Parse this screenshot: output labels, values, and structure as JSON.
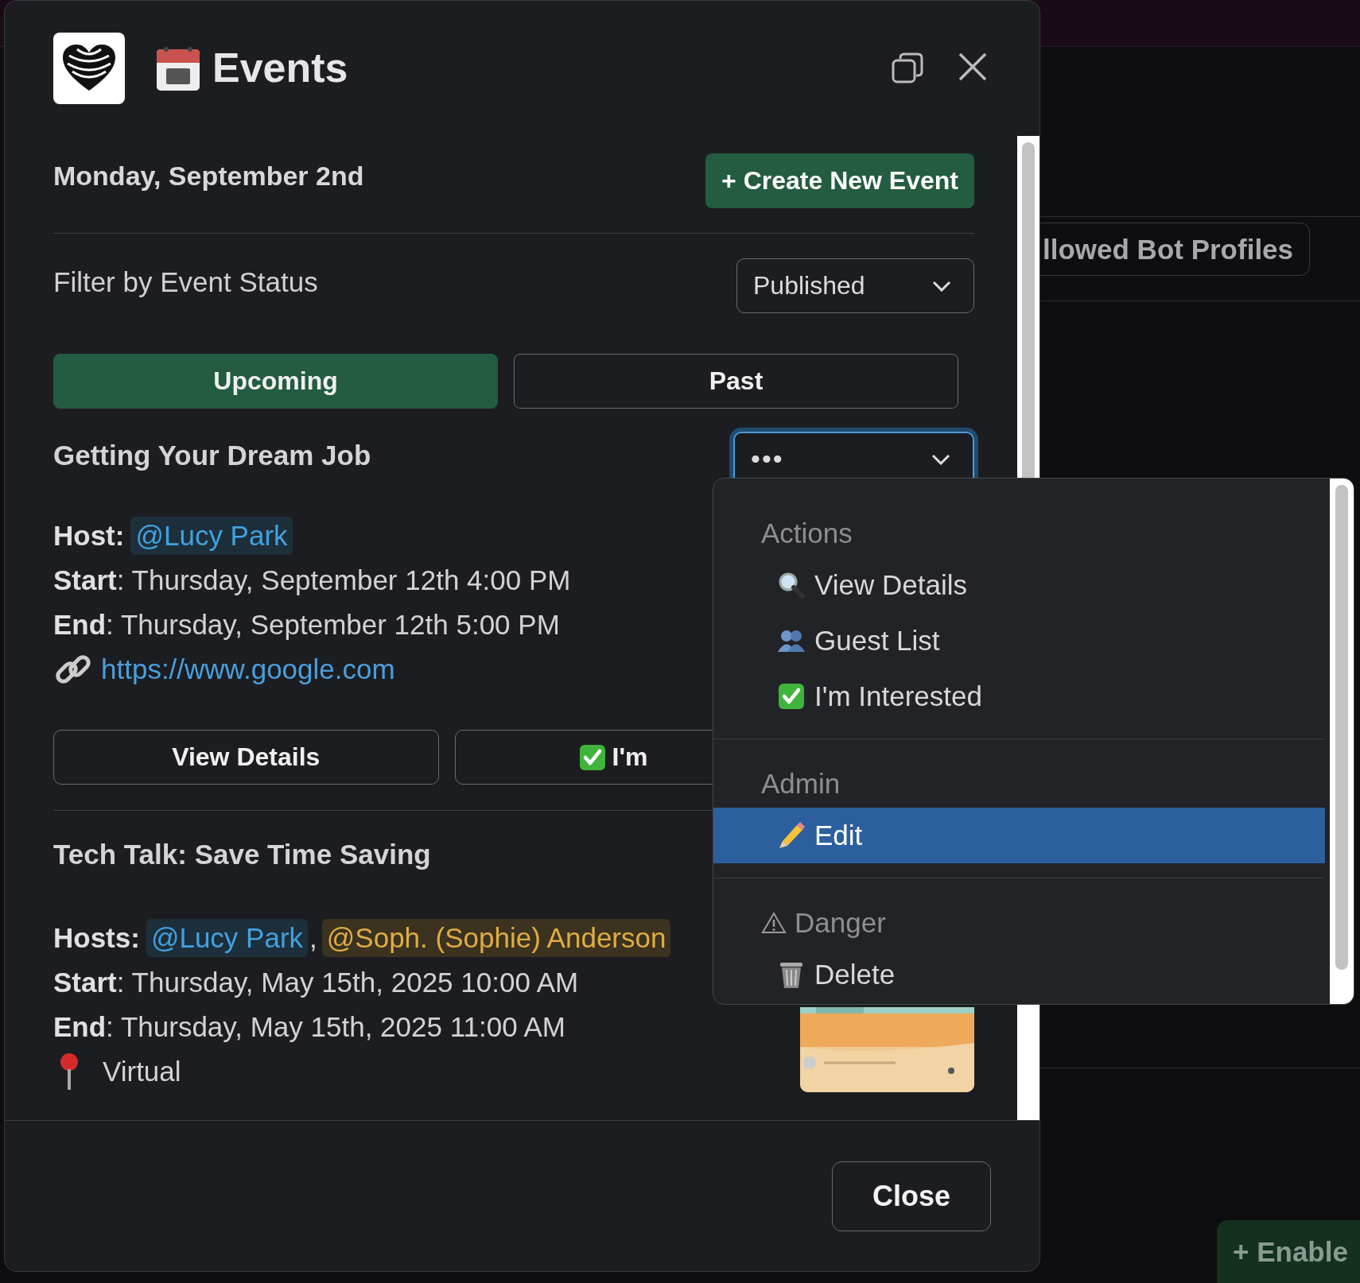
{
  "background": {
    "tab_label": "llowed Bot Profiles",
    "enable_button": "+ Enable"
  },
  "modal": {
    "title": "Events",
    "date": "Monday, September 2nd",
    "create_button": "+ Create New Event",
    "filter": {
      "label": "Filter by Event Status",
      "value": "Published"
    },
    "tabs": [
      {
        "label": "Upcoming",
        "selected": true
      },
      {
        "label": "Past",
        "selected": false
      }
    ],
    "events": [
      {
        "title": "Getting Your Dream Job",
        "menu": {
          "value": "•••",
          "focused": true
        },
        "lines": [
          {
            "kind": "hosts",
            "label": "Host:",
            "mentions": [
              {
                "text": "@Lucy Park",
                "color": "#1d2f3b"
              }
            ]
          },
          {
            "kind": "time",
            "text": "**Start**: Thursday, September 12th 4:00 PM"
          },
          {
            "kind": "time",
            "text": "**End**: Thursday, September 12th 5:00 PM"
          },
          {
            "kind": "link",
            "text": "https://www.google.com"
          }
        ],
        "buttons": [
          {
            "label": "View Details",
            "kind": "plain"
          },
          {
            "label": "I'm",
            "kind": "interest"
          }
        ]
      },
      {
        "title": "Tech Talk: Save Time Saving",
        "lines": [
          {
            "kind": "hosts",
            "label": "Hosts:",
            "separator": ",",
            "mentions": [
              {
                "text": "@Lucy Park",
                "color": "#1d2f3b"
              },
              {
                "text": "@Soph. (Sophie) Anderson",
                "color": "#3b3220"
              }
            ]
          },
          {
            "kind": "time",
            "text": "**Start**: Thursday, May 15th, 2025 10:00 AM"
          },
          {
            "kind": "time",
            "text": "**End**: Thursday, May 15th, 2025 11:00 AM"
          },
          {
            "kind": "location",
            "text": "Virtual"
          }
        ]
      }
    ],
    "close_button": "Close"
  },
  "dropdown": {
    "sections": [
      {
        "title": "Actions",
        "items": [
          {
            "label": "View Details",
            "kind": "view",
            "selected": false
          },
          {
            "label": "Guest List",
            "kind": "guests",
            "selected": false
          },
          {
            "label": "I'm Interested",
            "kind": "interest",
            "selected": false
          }
        ]
      },
      {
        "title": "Admin",
        "items": [
          {
            "label": "Edit",
            "kind": "edit",
            "selected": true
          }
        ]
      },
      {
        "title": "Danger",
        "kind": "danger",
        "items": [
          {
            "label": "Delete",
            "kind": "delete",
            "selected": false
          }
        ]
      }
    ]
  }
}
